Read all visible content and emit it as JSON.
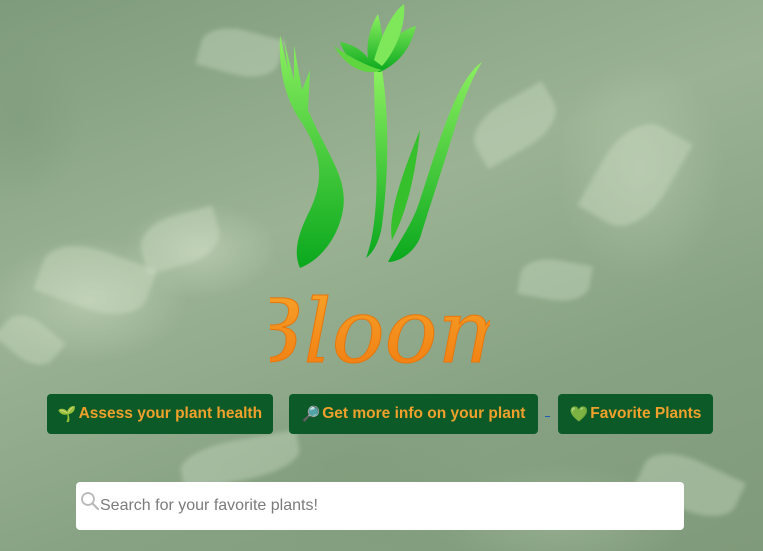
{
  "brand": {
    "name": "Bloom",
    "logo_icon": "hand-holding-tulip-icon",
    "colors": {
      "logo_green": "#22c42a",
      "logo_orange": "#f7931e"
    }
  },
  "nav": {
    "assess": {
      "icon": "🌱",
      "label": "Assess your plant health"
    },
    "info": {
      "icon": "🔎",
      "label": "Get more info on your plant"
    },
    "favorites": {
      "icon": "💚",
      "label": "Favorite Plants"
    },
    "colors": {
      "button_bg": "#0c5a28",
      "button_text": "#f0a12b"
    }
  },
  "search": {
    "icon": "search-icon",
    "value": "",
    "placeholder": "Search for your favorite plants!"
  }
}
